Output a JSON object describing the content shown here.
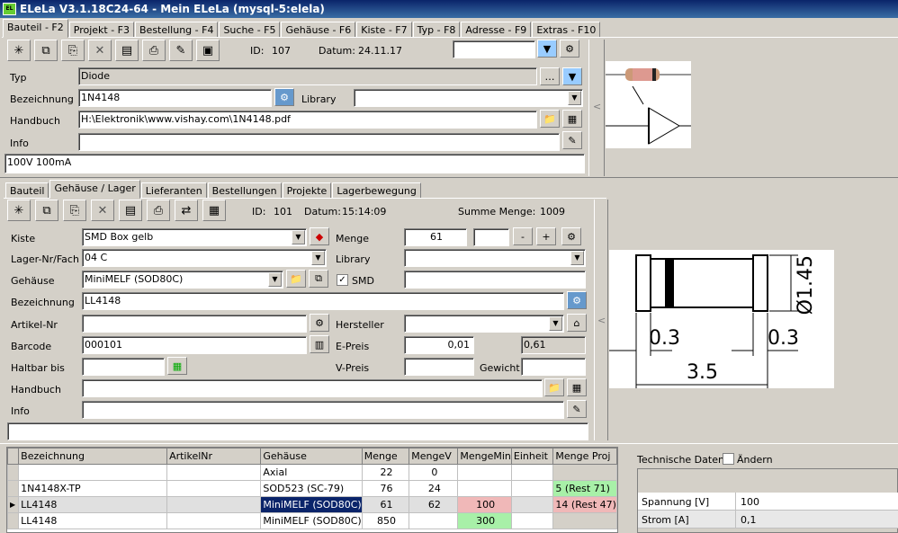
{
  "window": {
    "title": "ELeLa V3.1.18C24-64 - Mein ELeLa (mysql-5:elela)",
    "icon": "app-icon"
  },
  "main_tabs": [
    "Bauteil - F2",
    "Projekt - F3",
    "Bestellung - F4",
    "Suche - F5",
    "Gehäuse - F6",
    "Kiste - F7",
    "Typ - F8",
    "Adresse - F9",
    "Extras - F10"
  ],
  "part": {
    "id_label": "ID:",
    "id": "107",
    "datum_label": "Datum:",
    "datum": "24.11.17",
    "typ_label": "Typ",
    "typ": "Diode",
    "bezeichnung_label": "Bezeichnung",
    "bezeichnung": "1N4148",
    "library_label": "Library",
    "library": "",
    "handbuch_label": "Handbuch",
    "handbuch": "H:\\Elektronik\\www.vishay.com\\1N4148.pdf",
    "info_label": "Info",
    "info": "",
    "notes": "100V 100mA"
  },
  "sub_tabs": [
    "Bauteil",
    "Gehäuse / Lager",
    "Lieferanten",
    "Bestellungen",
    "Projekte",
    "Lagerbewegung"
  ],
  "storage": {
    "id_label": "ID:",
    "id": "101",
    "datum_label": "Datum:",
    "datum": "15:14:09",
    "summe_label": "Summe Menge:",
    "summe": "1009",
    "kiste_label": "Kiste",
    "kiste": "SMD Box gelb",
    "menge_label": "Menge",
    "menge": "61",
    "lager_label": "Lager-Nr/Fach",
    "lager": "04 C",
    "library_label": "Library",
    "library": "",
    "gehaeuse_label": "Gehäuse",
    "gehaeuse": "MiniMELF (SOD80C)",
    "smd_label": "SMD",
    "smd_checked": "✓",
    "bezeichnung_label": "Bezeichnung",
    "bezeichnung": "LL4148",
    "artikel_label": "Artikel-Nr",
    "artikel": "",
    "hersteller_label": "Hersteller",
    "hersteller": "",
    "barcode_label": "Barcode",
    "barcode": "000101",
    "epreis_label": "E-Preis",
    "epreis": "0,01",
    "epreis_total": "0,61",
    "haltbar_label": "Haltbar bis",
    "haltbar": "",
    "vpreis_label": "V-Preis",
    "vpreis": "",
    "gewicht_label": "Gewicht",
    "gewicht": "",
    "handbuch_label": "Handbuch",
    "handbuch": "",
    "info_label": "Info",
    "info": ""
  },
  "drawing": {
    "dim1": "Ø1.45",
    "dim2": "0.3",
    "dim3": "0.3",
    "dim4": "3.5"
  },
  "table": {
    "headers": [
      "Bezeichnung",
      "ArtikelNr",
      "Gehäuse",
      "Menge",
      "MengeV",
      "MengeMin",
      "Einheit",
      "Menge Proj"
    ],
    "rows": [
      {
        "c": [
          "",
          "",
          "Axial",
          "22",
          "0",
          "",
          "",
          ""
        ]
      },
      {
        "c": [
          "1N4148X-TP",
          "",
          "SOD523 (SC-79)",
          "76",
          "24",
          "",
          "",
          "5 (Rest 71)"
        ]
      },
      {
        "c": [
          "LL4148",
          "",
          "MiniMELF (SOD80C)",
          "61",
          "62",
          "100",
          "",
          "14 (Rest 47)"
        ]
      },
      {
        "c": [
          "LL4148",
          "",
          "MiniMELF (SOD80C)",
          "850",
          "",
          "300",
          "",
          ""
        ]
      }
    ]
  },
  "tech": {
    "label": "Technische Daten:",
    "aendern": "Ändern",
    "rows": [
      {
        "k": "Spannung [V]",
        "v": "100"
      },
      {
        "k": "Strom [A]",
        "v": "0,1"
      }
    ]
  },
  "colors": {
    "green": "#a8f0a8",
    "red": "#f0b8b8",
    "selected": "#0a246a"
  }
}
